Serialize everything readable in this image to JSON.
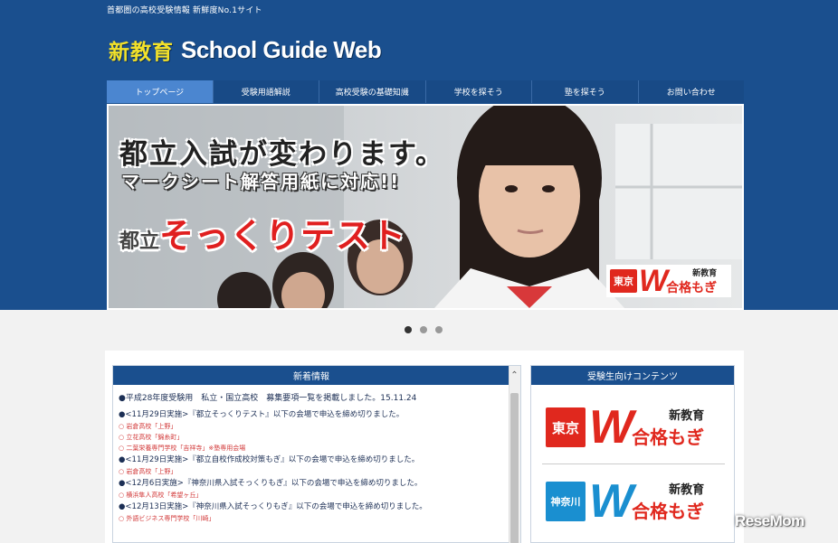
{
  "header": {
    "tagline": "首都圏の高校受験情報 新鮮度No.1サイト",
    "logo_jp": "新教育",
    "logo_en": "School Guide Web"
  },
  "nav": {
    "items": [
      {
        "label": "トップページ",
        "active": true
      },
      {
        "label": "受験用語解説",
        "active": false
      },
      {
        "label": "高校受験の基礎知識",
        "active": false
      },
      {
        "label": "学校を探そう",
        "active": false
      },
      {
        "label": "塾を探そう",
        "active": false
      },
      {
        "label": "お問い合わせ",
        "active": false
      }
    ]
  },
  "hero": {
    "headline": "都立入試が変わります。",
    "subline": "マークシート解答用紙に対応!!",
    "promo_prefix": "都立",
    "promo_main": "そっくりテスト",
    "badge": {
      "pref": "東京",
      "w": "W",
      "top": "新教育",
      "bottom": "合格もぎ"
    }
  },
  "carousel": {
    "total": 3,
    "active": 0
  },
  "news": {
    "title": "新着情報",
    "lines": [
      {
        "text": "●平成28年度受験用　私立・国立高校　募集要項一覧を掲載しました。15.11.24",
        "kind": "main"
      },
      {
        "text": "●<11月29日実施>『都立そっくりテスト』以下の会場で申込を締め切りました。",
        "kind": "main"
      },
      {
        "text": "○ 岩倉高校「上野」",
        "kind": "sub"
      },
      {
        "text": "○ 立花高校「錦糸町」",
        "kind": "sub"
      },
      {
        "text": "○ 二葉栄養専門学校「吉祥寺」※塾専用会場",
        "kind": "sub"
      },
      {
        "text": "●<11月29日実施>『都立自校作成校対策もぎ』以下の会場で申込を締め切りました。",
        "kind": "main"
      },
      {
        "text": "○ 岩倉高校「上野」",
        "kind": "sub"
      },
      {
        "text": "●<12月6日実施>『神奈川県入試そっくりもぎ』以下の会場で申込を締め切りました。",
        "kind": "main"
      },
      {
        "text": "○ 横浜隼人高校「希望ヶ丘」",
        "kind": "sub"
      },
      {
        "text": "●<12月13日実施>『神奈川県入試そっくりもぎ』以下の会場で申込を締め切りました。",
        "kind": "main"
      },
      {
        "text": "○ 外語ビジネス専門学校「川崎」",
        "kind": "sub"
      }
    ]
  },
  "side": {
    "title": "受験生向けコンテンツ",
    "banners": [
      {
        "pref": "東京",
        "w": "W",
        "top": "新教育",
        "bottom": "合格もぎ",
        "color": "#e0281e"
      },
      {
        "pref": "神奈川",
        "w": "W",
        "top": "新教育",
        "bottom": "合格もぎ",
        "color": "#1a8fd0"
      }
    ]
  },
  "watermark": "ReseMom"
}
